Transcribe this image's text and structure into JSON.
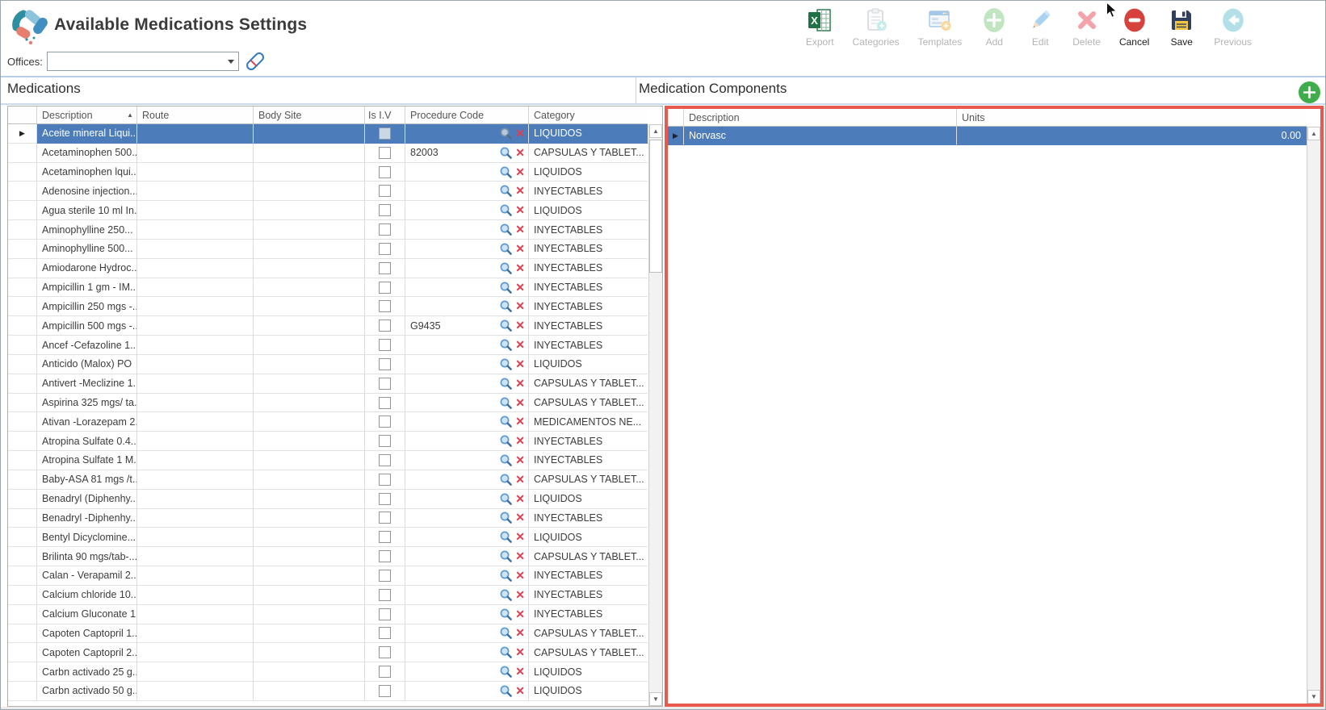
{
  "window": {
    "title": "Available Medications Settings"
  },
  "offices": {
    "label": "Offices:",
    "value": ""
  },
  "toolbar": {
    "buttons": [
      {
        "id": "export",
        "label": "Export",
        "enabled": true
      },
      {
        "id": "categories",
        "label": "Categories",
        "enabled": false
      },
      {
        "id": "templates",
        "label": "Templates",
        "enabled": false
      },
      {
        "id": "add",
        "label": "Add",
        "enabled": false
      },
      {
        "id": "edit",
        "label": "Edit",
        "enabled": false
      },
      {
        "id": "delete",
        "label": "Delete",
        "enabled": false
      },
      {
        "id": "cancel",
        "label": "Cancel",
        "enabled": true
      },
      {
        "id": "save",
        "label": "Save",
        "enabled": true
      },
      {
        "id": "previous",
        "label": "Previous",
        "enabled": false
      }
    ]
  },
  "panels": {
    "medications": {
      "title": "Medications",
      "columns": [
        "Description",
        "Route",
        "Body Site",
        "Is I.V",
        "Procedure Code",
        "Category"
      ],
      "sort": {
        "column": "Description",
        "direction": "asc"
      },
      "rows": [
        {
          "description": "Aceite mineral Liqui...",
          "route": "",
          "body_site": "",
          "is_iv": false,
          "procedure_code": "",
          "category": "LIQUIDOS",
          "selected": true
        },
        {
          "description": "Acetaminophen 500...",
          "route": "",
          "body_site": "",
          "is_iv": false,
          "procedure_code": "82003",
          "category": "CAPSULAS Y TABLET...",
          "selected": false
        },
        {
          "description": "Acetaminophen lqui...",
          "route": "",
          "body_site": "",
          "is_iv": false,
          "procedure_code": "",
          "category": "LIQUIDOS",
          "selected": false
        },
        {
          "description": "Adenosine injection...",
          "route": "",
          "body_site": "",
          "is_iv": false,
          "procedure_code": "",
          "category": "INYECTABLES",
          "selected": false
        },
        {
          "description": "Agua sterile 10 ml In...",
          "route": "",
          "body_site": "",
          "is_iv": false,
          "procedure_code": "",
          "category": "LIQUIDOS",
          "selected": false
        },
        {
          "description": "Aminophylline 250...",
          "route": "",
          "body_site": "",
          "is_iv": false,
          "procedure_code": "",
          "category": "INYECTABLES",
          "selected": false
        },
        {
          "description": "Aminophylline 500...",
          "route": "",
          "body_site": "",
          "is_iv": false,
          "procedure_code": "",
          "category": "INYECTABLES",
          "selected": false
        },
        {
          "description": "Amiodarone Hydroc...",
          "route": "",
          "body_site": "",
          "is_iv": false,
          "procedure_code": "",
          "category": "INYECTABLES",
          "selected": false
        },
        {
          "description": "Ampicillin 1 gm - IM...",
          "route": "",
          "body_site": "",
          "is_iv": false,
          "procedure_code": "",
          "category": "INYECTABLES",
          "selected": false
        },
        {
          "description": "Ampicillin 250 mgs -...",
          "route": "",
          "body_site": "",
          "is_iv": false,
          "procedure_code": "",
          "category": "INYECTABLES",
          "selected": false
        },
        {
          "description": "Ampicillin 500 mgs -...",
          "route": "",
          "body_site": "",
          "is_iv": false,
          "procedure_code": "G9435",
          "category": "INYECTABLES",
          "selected": false
        },
        {
          "description": "Ancef -Cefazoline  1...",
          "route": "",
          "body_site": "",
          "is_iv": false,
          "procedure_code": "",
          "category": "INYECTABLES",
          "selected": false
        },
        {
          "description": "Anticido (Malox) PO",
          "route": "",
          "body_site": "",
          "is_iv": false,
          "procedure_code": "",
          "category": "LIQUIDOS",
          "selected": false
        },
        {
          "description": "Antivert -Meclizine 1...",
          "route": "",
          "body_site": "",
          "is_iv": false,
          "procedure_code": "",
          "category": "CAPSULAS Y TABLET...",
          "selected": false
        },
        {
          "description": "Aspirina 325 mgs/ ta...",
          "route": "",
          "body_site": "",
          "is_iv": false,
          "procedure_code": "",
          "category": "CAPSULAS Y TABLET...",
          "selected": false
        },
        {
          "description": "Ativan -Lorazepam 2...",
          "route": "",
          "body_site": "",
          "is_iv": false,
          "procedure_code": "",
          "category": "MEDICAMENTOS NE...",
          "selected": false
        },
        {
          "description": "Atropina Sulfate 0.4...",
          "route": "",
          "body_site": "",
          "is_iv": false,
          "procedure_code": "",
          "category": "INYECTABLES",
          "selected": false
        },
        {
          "description": "Atropina Sulfate 1 M...",
          "route": "",
          "body_site": "",
          "is_iv": false,
          "procedure_code": "",
          "category": "INYECTABLES",
          "selected": false
        },
        {
          "description": "Baby-ASA 81 mgs /t...",
          "route": "",
          "body_site": "",
          "is_iv": false,
          "procedure_code": "",
          "category": "CAPSULAS Y TABLET...",
          "selected": false
        },
        {
          "description": "Benadryl (Diphenhy...",
          "route": "",
          "body_site": "",
          "is_iv": false,
          "procedure_code": "",
          "category": "LIQUIDOS",
          "selected": false
        },
        {
          "description": "Benadryl -Diphenhy...",
          "route": "",
          "body_site": "",
          "is_iv": false,
          "procedure_code": "",
          "category": "INYECTABLES",
          "selected": false
        },
        {
          "description": "Bentyl Dicyclomine...",
          "route": "",
          "body_site": "",
          "is_iv": false,
          "procedure_code": "",
          "category": "LIQUIDOS",
          "selected": false
        },
        {
          "description": "Brilinta 90 mgs/tab-...",
          "route": "",
          "body_site": "",
          "is_iv": false,
          "procedure_code": "",
          "category": "CAPSULAS Y TABLET...",
          "selected": false
        },
        {
          "description": "Calan - Verapamil 2....",
          "route": "",
          "body_site": "",
          "is_iv": false,
          "procedure_code": "",
          "category": "INYECTABLES",
          "selected": false
        },
        {
          "description": "Calcium chloride 10...",
          "route": "",
          "body_site": "",
          "is_iv": false,
          "procedure_code": "",
          "category": "INYECTABLES",
          "selected": false
        },
        {
          "description": "Calcium Gluconate 1...",
          "route": "",
          "body_site": "",
          "is_iv": false,
          "procedure_code": "",
          "category": "INYECTABLES",
          "selected": false
        },
        {
          "description": "Capoten Captopril 1...",
          "route": "",
          "body_site": "",
          "is_iv": false,
          "procedure_code": "",
          "category": "CAPSULAS Y TABLET...",
          "selected": false
        },
        {
          "description": "Capoten Captopril 2...",
          "route": "",
          "body_site": "",
          "is_iv": false,
          "procedure_code": "",
          "category": "CAPSULAS Y TABLET...",
          "selected": false
        },
        {
          "description": "Carbn activado 25 g...",
          "route": "",
          "body_site": "",
          "is_iv": false,
          "procedure_code": "",
          "category": "LIQUIDOS",
          "selected": false
        },
        {
          "description": "Carbn activado 50 g...",
          "route": "",
          "body_site": "",
          "is_iv": false,
          "procedure_code": "",
          "category": "LIQUIDOS",
          "selected": false
        }
      ]
    },
    "components": {
      "title": "Medication Components",
      "columns": [
        "Description",
        "Units"
      ],
      "rows": [
        {
          "description": "Norvasc",
          "units": "0.00",
          "selected": true
        }
      ]
    }
  },
  "colors": {
    "selection_blue": "#4d7cba",
    "error_border_red": "#e8594e",
    "add_green": "#3fad4b",
    "delete_red": "#e23d4c",
    "header_separator_blue": "#b7cde6"
  }
}
